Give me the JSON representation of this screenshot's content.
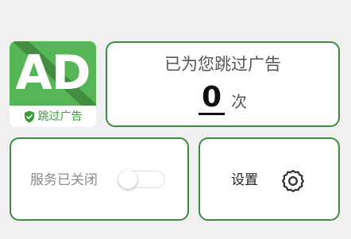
{
  "logo": {
    "text": "AD",
    "label": "跳过广告"
  },
  "skip_card": {
    "title": "已为您跳过广告",
    "count": "0",
    "unit": "次"
  },
  "service_card": {
    "label": "服务已关闭",
    "toggle_on": false
  },
  "settings_card": {
    "label": "设置",
    "icon": "gear-icon"
  },
  "colors": {
    "background": "#f0f0f0",
    "brand_green": "#56b556",
    "card_border": "#3f8a3f",
    "label_green": "#3b9a3b"
  }
}
